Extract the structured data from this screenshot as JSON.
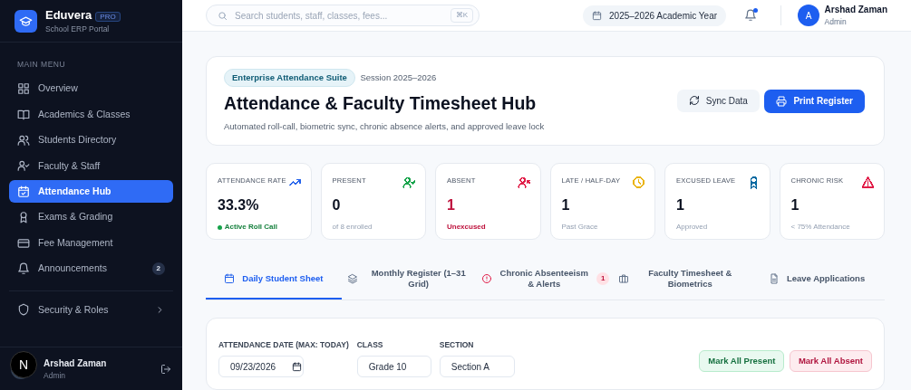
{
  "brand": {
    "name": "Eduvera",
    "tag": "PRO",
    "subtitle": "School ERP Portal"
  },
  "sidebar": {
    "section": "MAIN MENU",
    "items": [
      {
        "label": "Overview",
        "selected": false
      },
      {
        "label": "Academics & Classes",
        "selected": false
      },
      {
        "label": "Students Directory",
        "selected": false
      },
      {
        "label": "Faculty & Staff",
        "selected": false
      },
      {
        "label": "Attendance Hub",
        "selected": true
      },
      {
        "label": "Exams & Grading",
        "selected": false
      },
      {
        "label": "Fee Management",
        "selected": false
      },
      {
        "label": "Announcements",
        "selected": false,
        "badge": "2"
      }
    ],
    "footer_items": [
      {
        "label": "Security & Roles",
        "selected": false,
        "expanded": false
      }
    ],
    "user": {
      "name": "Arshad Zaman",
      "role": "Admin"
    },
    "dev_badge": "N"
  },
  "topbar": {
    "search": {
      "placeholder": "Search students, staff, classes, fees...",
      "shortcut": "⌘K"
    },
    "year": "2025–2026 Academic Year",
    "notifications_unread": true,
    "user": {
      "initial": "A",
      "name": "Arshad Zaman",
      "role": "Admin"
    }
  },
  "hero": {
    "tag": "Enterprise Attendance Suite",
    "session": "Session 2025–2026",
    "title": "Attendance & Faculty Timesheet Hub",
    "subtitle": "Automated roll-call, biometric sync, chronic absence alerts, and approved leave lock",
    "buttons": [
      {
        "label": "Sync Data",
        "kind": "secondary"
      },
      {
        "label": "Print Register",
        "kind": "primary"
      }
    ]
  },
  "stats": [
    {
      "label": "ATTENDANCE RATE",
      "value": "33.3%",
      "note": "Active Roll Call",
      "live": true,
      "alert": false,
      "color": "#2563eb"
    },
    {
      "label": "PRESENT",
      "value": "0",
      "note": "of 8 enrolled",
      "live": false,
      "alert": false,
      "color": "#16a34a"
    },
    {
      "label": "ABSENT",
      "value": "1",
      "note": "Unexcused",
      "live": false,
      "alert": true,
      "color": "#e11d48"
    },
    {
      "label": "LATE / HALF-DAY",
      "value": "1",
      "note": "Past Grace",
      "live": false,
      "alert": false,
      "color": "#eab308"
    },
    {
      "label": "EXCUSED LEAVE",
      "value": "1",
      "note": "Approved",
      "live": false,
      "alert": false,
      "color": "#0369a1"
    },
    {
      "label": "CHRONIC RISK",
      "value": "1",
      "note": "< 75% Attendance",
      "live": false,
      "alert": false,
      "color": "#e11d48"
    }
  ],
  "tabs": [
    {
      "label": "Daily Student Sheet",
      "selected": true
    },
    {
      "label": "Monthly Register (1–31 Grid)",
      "selected": false
    },
    {
      "label": "Chronic Absenteeism & Alerts",
      "selected": false,
      "badge": "1"
    },
    {
      "label": "Faculty Timesheet & Biometrics",
      "selected": false
    },
    {
      "label": "Leave Applications",
      "selected": false
    }
  ],
  "filters": {
    "fields": [
      {
        "label": "ATTENDANCE DATE (MAX: TODAY)",
        "kind": "date",
        "value": "09/23/2026"
      },
      {
        "label": "CLASS",
        "kind": "select",
        "value": "Grade 10"
      },
      {
        "label": "SECTION",
        "kind": "select",
        "value": "Section A"
      }
    ],
    "buttons": [
      {
        "label": "Mark All Present",
        "kind": "success"
      },
      {
        "label": "Mark All Absent",
        "kind": "danger"
      }
    ]
  }
}
